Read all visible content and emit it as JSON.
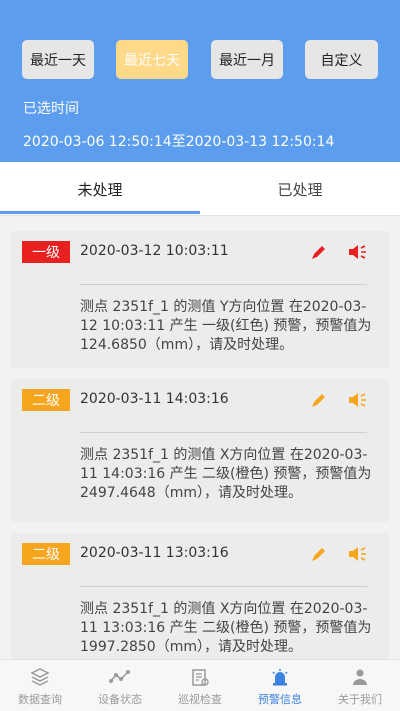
{
  "filters": {
    "buttons": [
      {
        "label": "最近一天",
        "active": false
      },
      {
        "label": "最近七天",
        "active": true
      },
      {
        "label": "最近一月",
        "active": false
      },
      {
        "label": "自定义",
        "active": false
      }
    ],
    "selected_label": "已选时间",
    "selected_range": "2020-03-06 12:50:14至2020-03-13 12:50:14"
  },
  "tabs": [
    {
      "label": "未处理",
      "active": true
    },
    {
      "label": "已处理",
      "active": false
    }
  ],
  "alerts": [
    {
      "level": "一级",
      "level_color": "#e8201f",
      "time": "2020-03-12 10:03:11",
      "message": "测点 2351f_1 的测值 Y方向位置 在2020-03-12 10:03:11 产生 一级(红色) 预警，预警值为 124.6850（mm），请及时处理。"
    },
    {
      "level": "二级",
      "level_color": "#f7a51d",
      "time": "2020-03-11 14:03:16",
      "message": "测点 2351f_1 的测值 X方向位置 在2020-03-11 14:03:16 产生 二级(橙色) 预警，预警值为 2497.4648（mm），请及时处理。"
    },
    {
      "level": "二级",
      "level_color": "#f7a51d",
      "time": "2020-03-11 13:03:16",
      "message": "测点 2351f_1 的测值 X方向位置 在2020-03-11 13:03:16 产生 二级(橙色) 预警，预警值为 1997.2850（mm），请及时处理。"
    }
  ],
  "bottom_nav": [
    {
      "label": "数据查询",
      "icon": "layers-icon",
      "active": false
    },
    {
      "label": "设备状态",
      "icon": "network-icon",
      "active": false
    },
    {
      "label": "巡视检查",
      "icon": "inspection-icon",
      "active": false
    },
    {
      "label": "预警信息",
      "icon": "alarm-icon",
      "active": true
    },
    {
      "label": "关于我们",
      "icon": "person-icon",
      "active": false
    }
  ],
  "colors": {
    "header_bg": "#5c9ded",
    "active_button_bg": "#ffd98a",
    "level1": "#e8201f",
    "level2": "#f7a51d",
    "nav_active": "#3c82e0"
  }
}
